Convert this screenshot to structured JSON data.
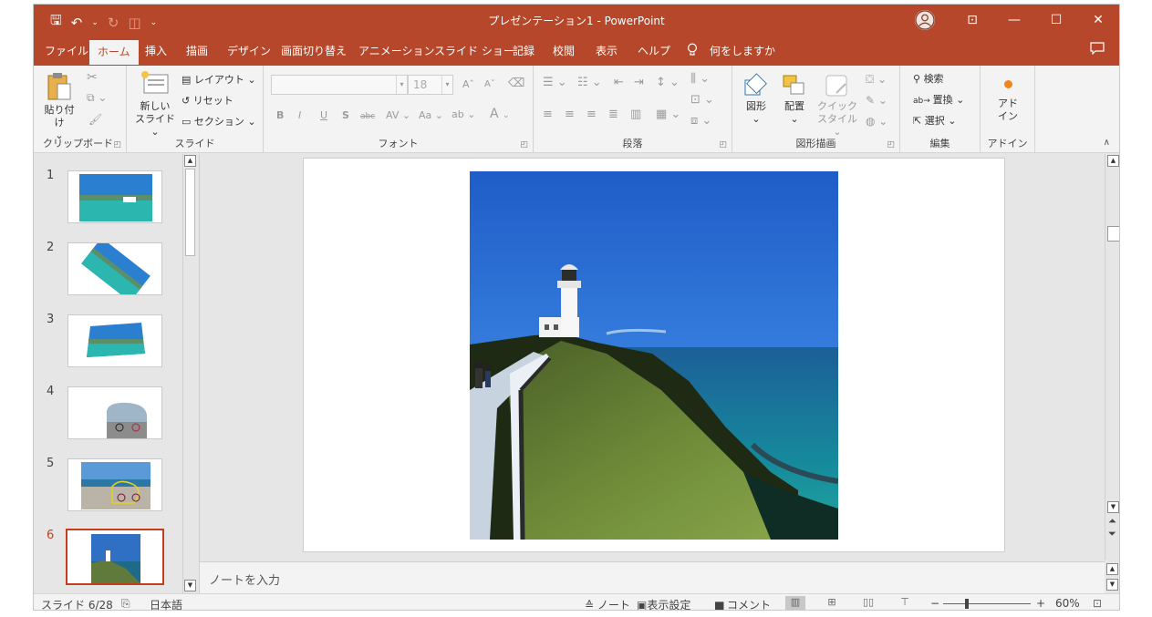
{
  "window": {
    "title": "プレゼンテーション1  -  PowerPoint",
    "controls": {
      "ribbon_display": "⊡",
      "minimize": "—",
      "maximize": "☐",
      "close": "✕"
    }
  },
  "qat": {
    "save": "🖫",
    "undo": "↶",
    "undo_dd": "⌄",
    "redo": "↻",
    "start": "◫",
    "customize": "⌄"
  },
  "tabs": {
    "file": "ファイル",
    "home": "ホーム",
    "insert": "挿入",
    "draw": "描画",
    "design": "デザイン",
    "transitions": "画面切り替え",
    "animations": "アニメーション",
    "slideshow": "スライド ショー",
    "record": "記録",
    "review": "校閲",
    "view": "表示",
    "help": "ヘルプ",
    "tellme": "何をしますか",
    "active": "ホーム"
  },
  "ribbon": {
    "clipboard": {
      "label": "クリップボード",
      "paste": "貼り付け",
      "paste_dd": "⌄"
    },
    "slides": {
      "label": "スライド",
      "new_slide_1": "新しい",
      "new_slide_2": "スライド ⌄",
      "layout": "レイアウト ⌄",
      "reset": "リセット",
      "section": "セクション ⌄"
    },
    "font": {
      "label": "フォント",
      "font_size": "18",
      "bold": "B",
      "italic": "I",
      "underline": "U",
      "shadow": "S",
      "strike": "abc",
      "spacing": "AV",
      "case": "Aa",
      "grow": "A",
      "shrink": "A",
      "color": "A"
    },
    "paragraph": {
      "label": "段落"
    },
    "drawing": {
      "label": "図形描画",
      "shapes": "図形",
      "arrange": "配置",
      "quick_styles_1": "クイック",
      "quick_styles_2": "スタイル ⌄"
    },
    "editing": {
      "label": "編集",
      "find": "検索",
      "replace": "置換 ⌄",
      "select": "選択 ⌄"
    },
    "addins": {
      "label": "アドイン",
      "addins_1": "アド",
      "addins_2": "イン"
    }
  },
  "slides": [
    {
      "number": "1"
    },
    {
      "number": "2"
    },
    {
      "number": "3"
    },
    {
      "number": "4"
    },
    {
      "number": "5"
    },
    {
      "number": "6"
    }
  ],
  "active_slide": "6",
  "notes": {
    "placeholder": "ノートを入力"
  },
  "status": {
    "slide_counter": "スライド 6/28",
    "language": "日本語",
    "notes_btn": "ノート",
    "display_settings": "表示設定",
    "comments": "コメント",
    "zoom": "60%",
    "zoom_minus": "−",
    "zoom_plus": "+"
  },
  "colors": {
    "accent": "#b7472a",
    "active_border": "#c43e1c"
  }
}
